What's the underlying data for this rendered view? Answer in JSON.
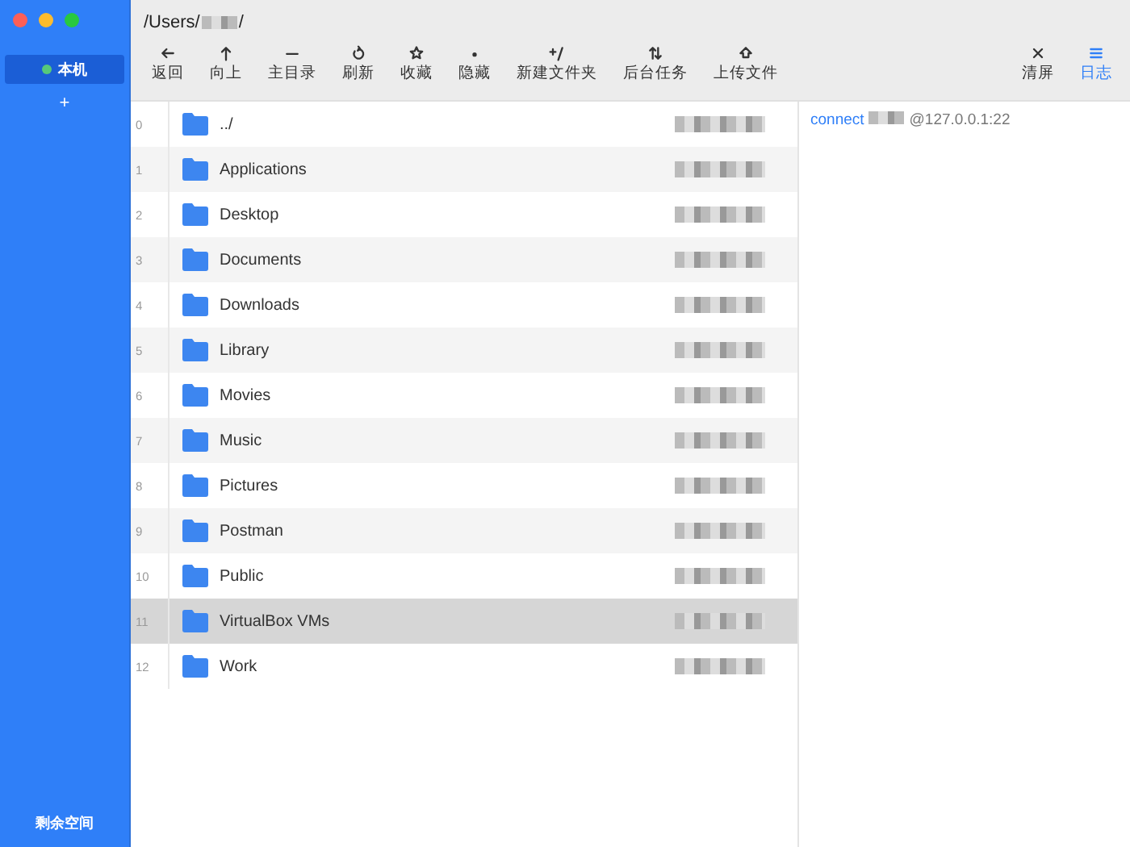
{
  "sidebar": {
    "hosts": [
      {
        "label": "本机",
        "selected": true,
        "online": true
      }
    ],
    "add": "+",
    "footer": "剩余空间"
  },
  "path": {
    "prefix": "/Users/",
    "suffix": "/"
  },
  "toolbar": [
    {
      "label": "返回",
      "active": false
    },
    {
      "label": "向上",
      "active": false
    },
    {
      "label": "主目录",
      "active": false
    },
    {
      "label": "刷新",
      "active": false
    },
    {
      "label": "收藏",
      "active": false
    },
    {
      "label": "隐藏",
      "active": false
    },
    {
      "label": "新建文件夹",
      "active": false
    },
    {
      "label": "后台任务",
      "active": false
    },
    {
      "label": "上传文件",
      "active": false
    }
  ],
  "toolbar_right": [
    {
      "label": "清屏",
      "active": false
    },
    {
      "label": "日志",
      "active": true
    }
  ],
  "files": [
    {
      "index": "0",
      "name": "../",
      "selected": false
    },
    {
      "index": "1",
      "name": "Applications",
      "selected": false
    },
    {
      "index": "2",
      "name": "Desktop",
      "selected": false
    },
    {
      "index": "3",
      "name": "Documents",
      "selected": false
    },
    {
      "index": "4",
      "name": "Downloads",
      "selected": false
    },
    {
      "index": "5",
      "name": "Library",
      "selected": false
    },
    {
      "index": "6",
      "name": "Movies",
      "selected": false
    },
    {
      "index": "7",
      "name": "Music",
      "selected": false
    },
    {
      "index": "8",
      "name": "Pictures",
      "selected": false
    },
    {
      "index": "9",
      "name": "Postman",
      "selected": false
    },
    {
      "index": "10",
      "name": "Public",
      "selected": false
    },
    {
      "index": "11",
      "name": "VirtualBox VMs",
      "selected": true
    },
    {
      "index": "12",
      "name": "Work",
      "selected": false
    }
  ],
  "log": {
    "command": "connect",
    "target": "@127.0.0.1:22"
  }
}
